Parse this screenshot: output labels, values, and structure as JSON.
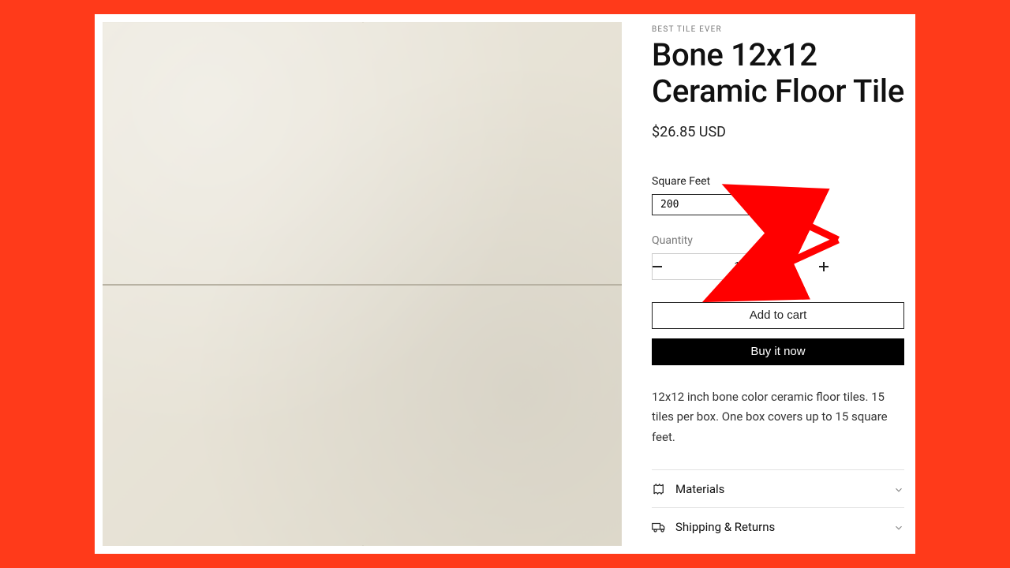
{
  "annotation_color": "#ff0000",
  "product": {
    "vendor": "BEST TILE EVER",
    "title": "Bone 12x12 Ceramic Floor Tile",
    "price": "$26.85 USD",
    "description": "12x12 inch bone color ceramic floor tiles.  15 tiles per box.  One box covers up to 15 square feet."
  },
  "form": {
    "sqft_label": "Square Feet",
    "sqft_value": "200",
    "qty_label": "Quantity",
    "qty_value": "14",
    "add_to_cart": "Add to cart",
    "buy_now": "Buy it now"
  },
  "accordion": {
    "materials": "Materials",
    "shipping": "Shipping & Returns"
  }
}
